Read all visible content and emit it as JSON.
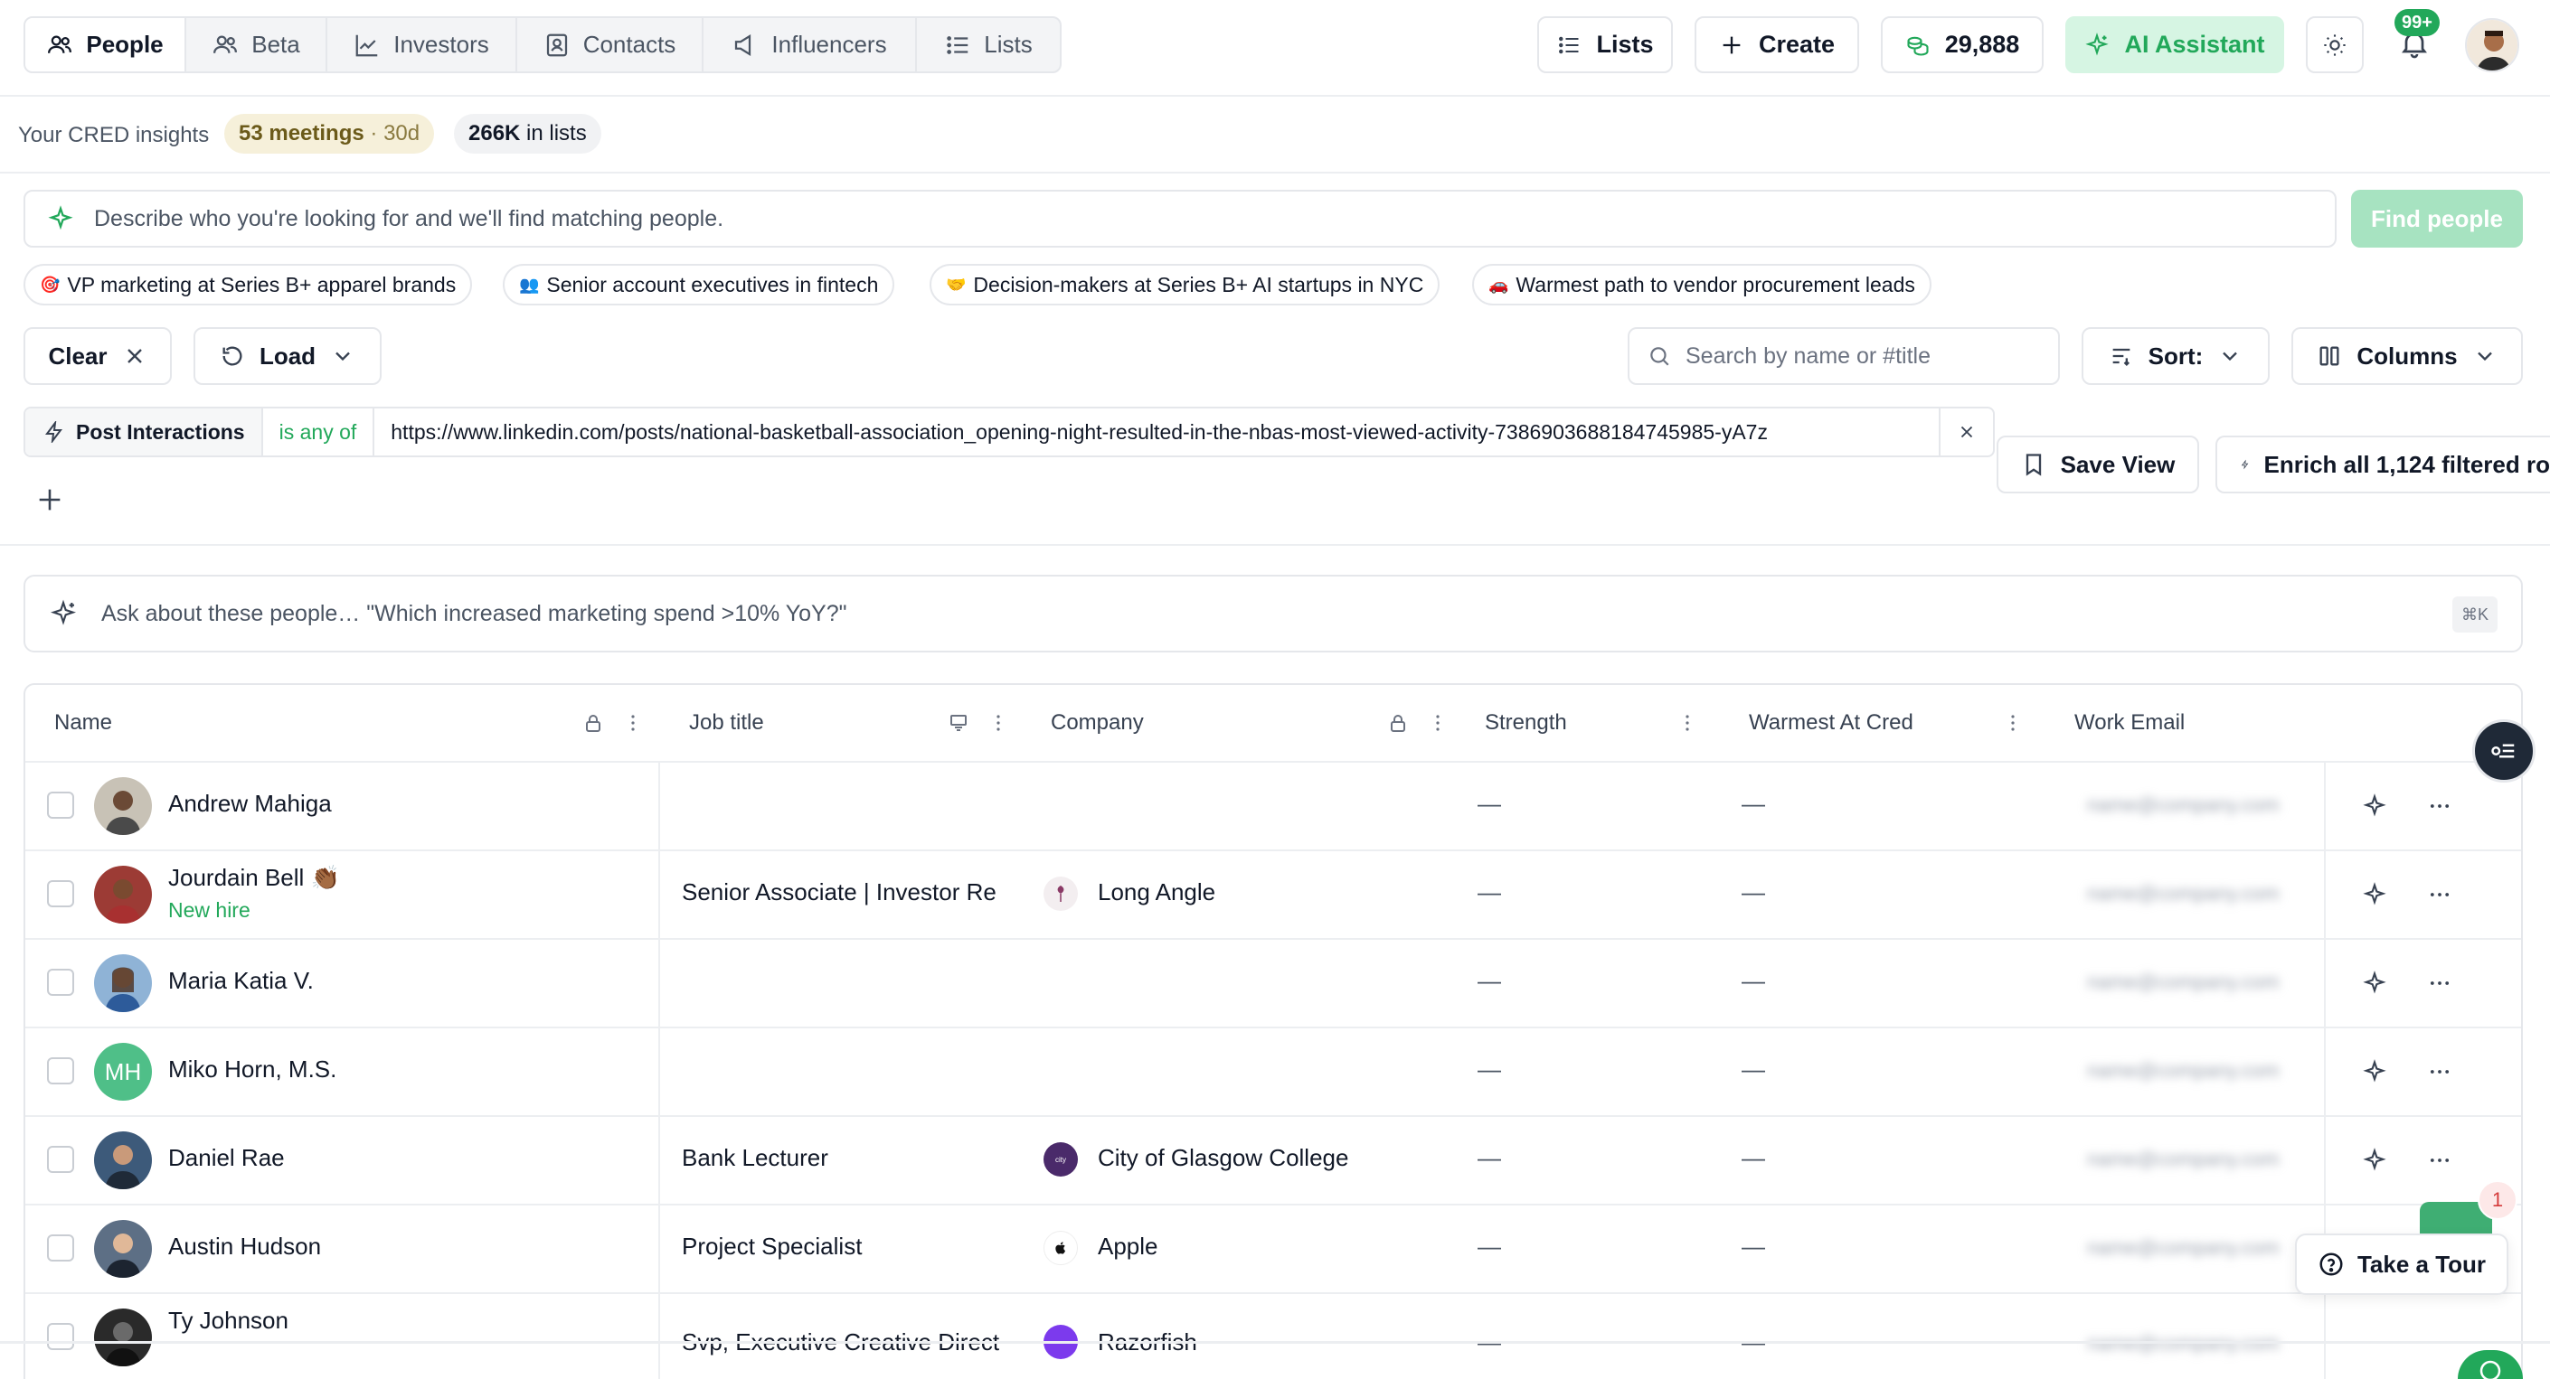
{
  "nav": {
    "tabs": [
      {
        "label": "People",
        "icon": "users-icon",
        "active": true
      },
      {
        "label": "Beta",
        "icon": "users-icon"
      },
      {
        "label": "Investors",
        "icon": "chart-line-icon"
      },
      {
        "label": "Contacts",
        "icon": "contact-card-icon"
      },
      {
        "label": "Influencers",
        "icon": "megaphone-icon"
      },
      {
        "label": "Lists",
        "icon": "list-icon"
      }
    ]
  },
  "topbar": {
    "lists_label": "Lists",
    "create_label": "Create",
    "credits_value": "29,888",
    "ai_assistant_label": "AI Assistant",
    "notification_badge": "99+"
  },
  "insights": {
    "label": "Your CRED insights",
    "meetings_pill": "53 meetings",
    "meetings_period": "· 30d",
    "lists_pill_value": "266K",
    "lists_pill_suffix": "in lists"
  },
  "search": {
    "placeholder": "Describe who you're looking for and we'll find matching people.",
    "find_button": "Find people"
  },
  "suggestions": [
    {
      "emoji": "🎯",
      "text": "VP marketing at Series B+ apparel brands"
    },
    {
      "emoji": "👥",
      "text": "Senior account executives in fintech"
    },
    {
      "emoji": "🤝",
      "text": "Decision-makers at Series B+ AI startups in NYC"
    },
    {
      "emoji": "🚗",
      "text": "Warmest path to vendor procurement leads"
    }
  ],
  "controls": {
    "clear_label": "Clear",
    "load_label": "Load",
    "search_placeholder": "Search by name or #title",
    "sort_label": "Sort:",
    "columns_label": "Columns",
    "save_view_label": "Save View",
    "enrich_label": "Enrich all 1,124 filtered ro"
  },
  "filter": {
    "field": "Post Interactions",
    "operator": "is any of",
    "value": "https://www.linkedin.com/posts/national-basketball-association_opening-night-resulted-in-the-nbas-most-viewed-activity-7386903688184745985-yA7z"
  },
  "ask": {
    "placeholder": "Ask about these people… \"Which increased marketing spend >10% YoY?\"",
    "shortcut": "⌘K"
  },
  "table": {
    "columns": [
      "Name",
      "Job title",
      "Company",
      "Strength",
      "Warmest At Cred",
      "Work Email"
    ],
    "rows": [
      {
        "name": "Andrew Mahiga",
        "tag": "",
        "title": "",
        "company": "",
        "company_logo": "",
        "strength": "—",
        "warmest": "—",
        "email": "name@company.com"
      },
      {
        "name": "Jourdain Bell 👏🏾",
        "tag": "New hire",
        "title": "Senior Associate | Investor Re",
        "company": "Long Angle",
        "company_logo": "long-angle",
        "strength": "—",
        "warmest": "—",
        "email": "name@company.com"
      },
      {
        "name": "Maria Katia V.",
        "tag": "",
        "title": "",
        "company": "",
        "company_logo": "",
        "strength": "—",
        "warmest": "—",
        "email": "name@company.com"
      },
      {
        "name": "Miko Horn, M.S.",
        "tag": "",
        "title": "",
        "company": "",
        "company_logo": "",
        "strength": "—",
        "warmest": "—",
        "email": "name@company.com",
        "initials": "MH"
      },
      {
        "name": "Daniel Rae",
        "tag": "",
        "title": "Bank Lecturer",
        "company": "City of Glasgow College",
        "company_logo": "glasgow",
        "strength": "—",
        "warmest": "—",
        "email": "name@company.com"
      },
      {
        "name": "Austin Hudson",
        "tag": "",
        "title": "Project Specialist",
        "company": "Apple",
        "company_logo": "apple",
        "strength": "—",
        "warmest": "—",
        "email": "name@company.com"
      },
      {
        "name": "Ty Johnson",
        "tag": "",
        "title": "Svp, Executive Creative Direct",
        "company": "Razorfish",
        "company_logo": "razorfish",
        "strength": "—",
        "warmest": "—",
        "email": "name@company.com"
      }
    ]
  },
  "floating": {
    "tour_label": "Take a Tour",
    "tour_badge": "1"
  },
  "colors": {
    "accent_green": "#22a85a",
    "ai_button_bg": "#d6f5e3",
    "meetings_pill_bg": "#f6f0da"
  }
}
